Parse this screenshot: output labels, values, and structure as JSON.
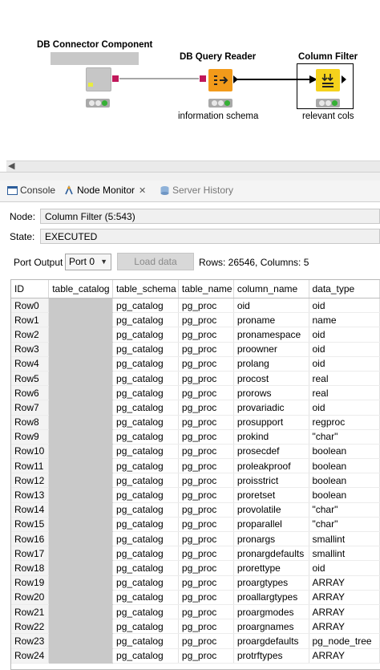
{
  "workflow": {
    "nodes": [
      {
        "label": "DB Connector Component",
        "sublabel": ""
      },
      {
        "label": "DB Query Reader",
        "sublabel": "information schema"
      },
      {
        "label": "Column Filter",
        "sublabel": "relevant cols"
      }
    ]
  },
  "tabs": [
    {
      "label": "Console"
    },
    {
      "label": "Node Monitor"
    },
    {
      "label": "Server History"
    }
  ],
  "node_info": {
    "node_label": "Node:",
    "node_value": "Column Filter  (5:543)",
    "state_label": "State:",
    "state_value": "EXECUTED"
  },
  "port_bar": {
    "label": "Port Output",
    "selected": "Port 0",
    "load_button": "Load data",
    "info": "Rows: 26546, Columns: 5"
  },
  "table": {
    "headers": [
      "ID",
      "table_catalog",
      "table_schema",
      "table_name",
      "column_name",
      "data_type"
    ],
    "rows": [
      [
        "Row0",
        "",
        "pg_catalog",
        "pg_proc",
        "oid",
        "oid"
      ],
      [
        "Row1",
        "",
        "pg_catalog",
        "pg_proc",
        "proname",
        "name"
      ],
      [
        "Row2",
        "",
        "pg_catalog",
        "pg_proc",
        "pronamespace",
        "oid"
      ],
      [
        "Row3",
        "",
        "pg_catalog",
        "pg_proc",
        "proowner",
        "oid"
      ],
      [
        "Row4",
        "",
        "pg_catalog",
        "pg_proc",
        "prolang",
        "oid"
      ],
      [
        "Row5",
        "",
        "pg_catalog",
        "pg_proc",
        "procost",
        "real"
      ],
      [
        "Row6",
        "",
        "pg_catalog",
        "pg_proc",
        "prorows",
        "real"
      ],
      [
        "Row7",
        "",
        "pg_catalog",
        "pg_proc",
        "provariadic",
        "oid"
      ],
      [
        "Row8",
        "",
        "pg_catalog",
        "pg_proc",
        "prosupport",
        "regproc"
      ],
      [
        "Row9",
        "",
        "pg_catalog",
        "pg_proc",
        "prokind",
        "\"char\""
      ],
      [
        "Row10",
        "",
        "pg_catalog",
        "pg_proc",
        "prosecdef",
        "boolean"
      ],
      [
        "Row11",
        "",
        "pg_catalog",
        "pg_proc",
        "proleakproof",
        "boolean"
      ],
      [
        "Row12",
        "",
        "pg_catalog",
        "pg_proc",
        "proisstrict",
        "boolean"
      ],
      [
        "Row13",
        "",
        "pg_catalog",
        "pg_proc",
        "proretset",
        "boolean"
      ],
      [
        "Row14",
        "",
        "pg_catalog",
        "pg_proc",
        "provolatile",
        "\"char\""
      ],
      [
        "Row15",
        "",
        "pg_catalog",
        "pg_proc",
        "proparallel",
        "\"char\""
      ],
      [
        "Row16",
        "",
        "pg_catalog",
        "pg_proc",
        "pronargs",
        "smallint"
      ],
      [
        "Row17",
        "",
        "pg_catalog",
        "pg_proc",
        "pronargdefaults",
        "smallint"
      ],
      [
        "Row18",
        "",
        "pg_catalog",
        "pg_proc",
        "prorettype",
        "oid"
      ],
      [
        "Row19",
        "",
        "pg_catalog",
        "pg_proc",
        "proargtypes",
        "ARRAY"
      ],
      [
        "Row20",
        "",
        "pg_catalog",
        "pg_proc",
        "proallargtypes",
        "ARRAY"
      ],
      [
        "Row21",
        "",
        "pg_catalog",
        "pg_proc",
        "proargmodes",
        "ARRAY"
      ],
      [
        "Row22",
        "",
        "pg_catalog",
        "pg_proc",
        "proargnames",
        "ARRAY"
      ],
      [
        "Row23",
        "",
        "pg_catalog",
        "pg_proc",
        "proargdefaults",
        "pg_node_tree"
      ],
      [
        "Row24",
        "",
        "pg_catalog",
        "pg_proc",
        "protrftypes",
        "ARRAY"
      ]
    ]
  },
  "colors": {
    "query_reader": "#f29a1a",
    "column_filter": "#f5d21c",
    "connector_port": "#c0185a",
    "status_green": "#35b035"
  },
  "icons": {
    "connector": "component-icon",
    "query_reader": "db-reader-icon",
    "column_filter": "filter-icon"
  }
}
